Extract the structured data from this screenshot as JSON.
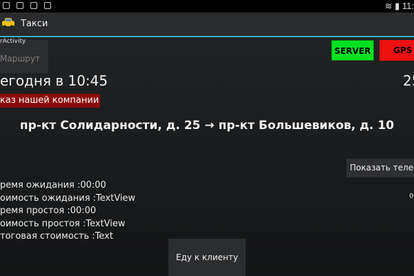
{
  "status_bar": {
    "icons": [
      "message-icon",
      "alert-icon",
      "image-icon",
      "image-icon"
    ],
    "time": "11:"
  },
  "action_bar": {
    "title": "Такси"
  },
  "activity_label": "rActivity",
  "route_button_label": "Маршрут",
  "server_button_label": "SERVER",
  "gps_button_label": "GPS",
  "server_color": "#00e020",
  "gps_color": "#ee1111",
  "time_label": "егодня в 10:45",
  "right_number": "25",
  "company_label": "каз нашей компании",
  "route": "пр-кт Солидарности, д. 25 → пр-кт Большевиков, д. 10",
  "show_phone_label": "Показать телефон",
  "info_lines": [
    "ремя ожидания :00:00",
    "оимость ожидания :TextView",
    "ремя простоя :00:00",
    "оимость простоя :TextView",
    "тоговая стоимость :Text"
  ],
  "right_small": "0",
  "drive_button_label": "Еду к клиенту"
}
